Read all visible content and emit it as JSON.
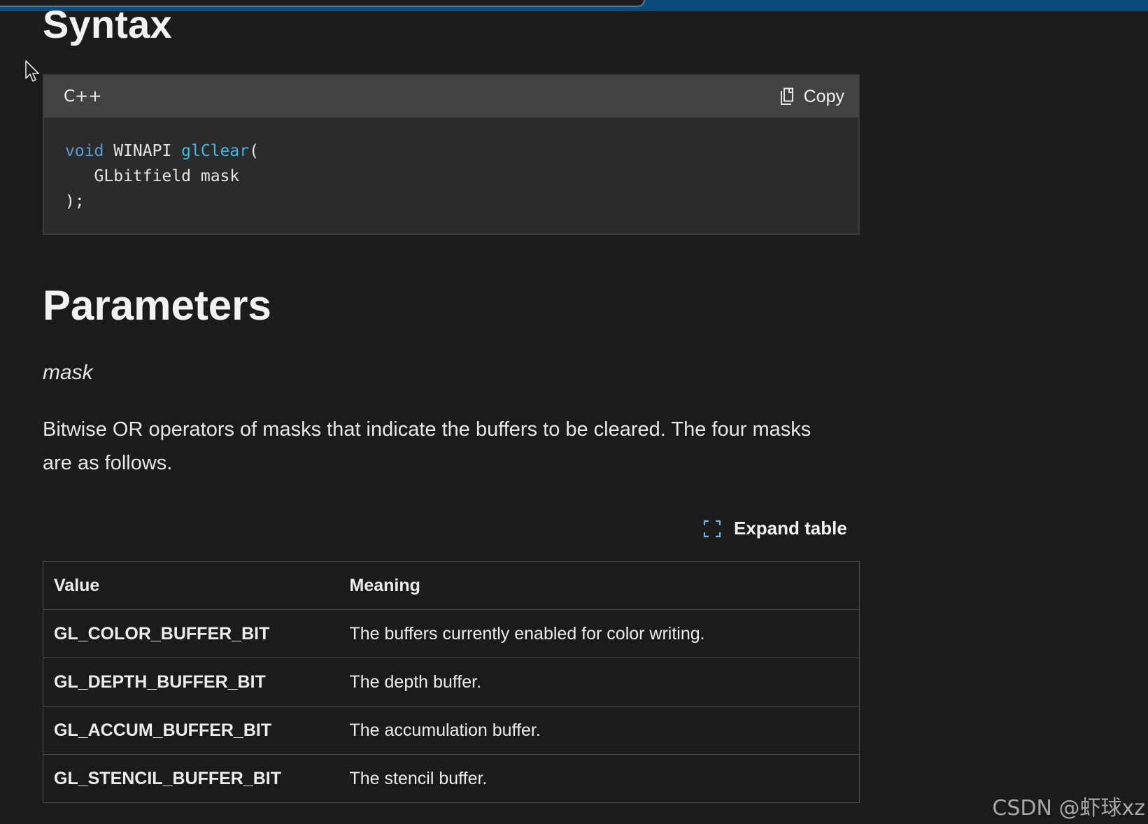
{
  "headings": {
    "syntax": "Syntax",
    "parameters": "Parameters"
  },
  "code_block": {
    "language": "C++",
    "copy_label": "Copy",
    "copy_icon": "copy-icon",
    "lines": {
      "l1_kw": "void",
      "l1_mid": " WINAPI ",
      "l1_fn": "glClear",
      "l1_end": "(",
      "l2": "   GLbitfield mask",
      "l3": ");"
    }
  },
  "parameter": {
    "name": "mask",
    "description": "Bitwise OR operators of masks that indicate the buffers to be cleared. The four masks are as follows."
  },
  "expand_table": {
    "label": "Expand table",
    "icon": "expand-icon"
  },
  "table": {
    "headers": [
      "Value",
      "Meaning"
    ],
    "rows": [
      [
        "GL_COLOR_BUFFER_BIT",
        "The buffers currently enabled for color writing."
      ],
      [
        "GL_DEPTH_BUFFER_BIT",
        "The depth buffer."
      ],
      [
        "GL_ACCUM_BUFFER_BIT",
        "The accumulation buffer."
      ],
      [
        "GL_STENCIL_BUFFER_BIT",
        "The stencil buffer."
      ]
    ]
  },
  "watermark": "CSDN @虾球xz",
  "colors": {
    "background": "#1b1b1b",
    "code_header": "#424242",
    "code_body": "#2b2b2b",
    "keyword": "#569cd6",
    "function": "#3fb7e8",
    "accent_icon": "#75b6e7"
  }
}
